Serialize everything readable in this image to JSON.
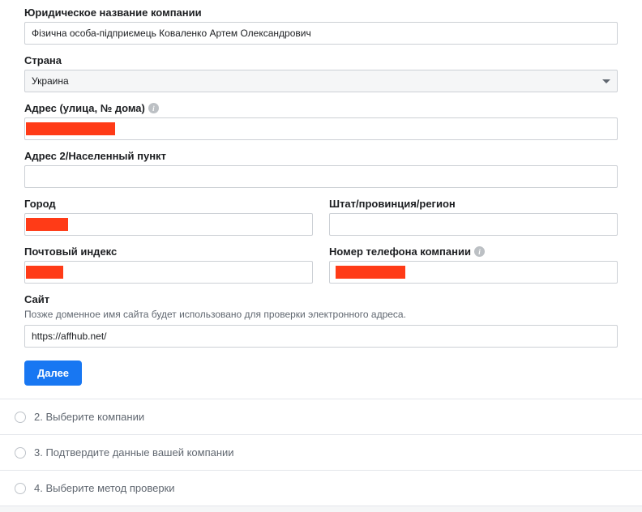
{
  "form": {
    "company_name": {
      "label": "Юридическое название компании",
      "value": "Фізична особа-підприємець Коваленко Артем Олександрович"
    },
    "country": {
      "label": "Страна",
      "value": "Украина"
    },
    "address1": {
      "label": "Адрес (улица, № дома)"
    },
    "address2": {
      "label": "Адрес 2/Населенный пункт"
    },
    "city": {
      "label": "Город"
    },
    "state": {
      "label": "Штат/провинция/регион"
    },
    "postal": {
      "label": "Почтовый индекс"
    },
    "phone": {
      "label": "Номер телефона компании"
    },
    "site": {
      "label": "Сайт",
      "helper": "Позже доменное имя сайта будет использовано для проверки электронного адреса.",
      "value": "https://affhub.net/"
    },
    "next_button": "Далее"
  },
  "steps": {
    "s2": "2. Выберите компании",
    "s3": "3. Подтвердите данные вашей компании",
    "s4": "4. Выберите метод проверки"
  }
}
